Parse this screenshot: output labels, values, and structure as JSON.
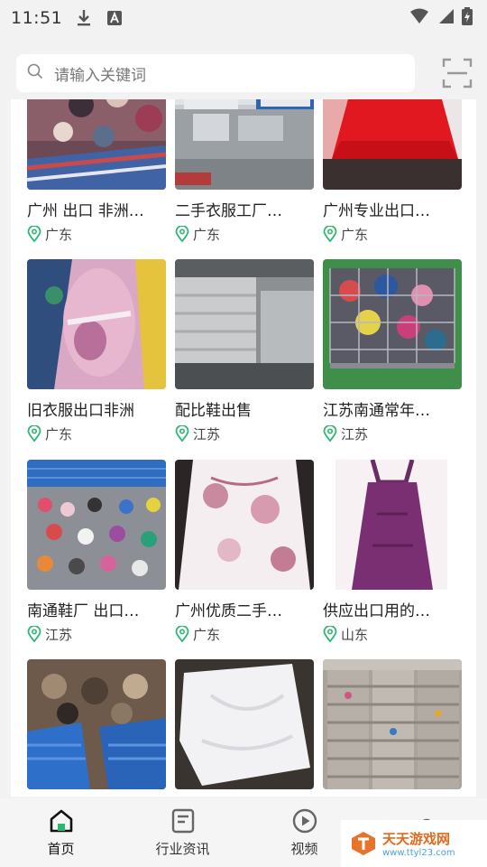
{
  "status": {
    "time": "11:51"
  },
  "search": {
    "placeholder": "请输入关键词"
  },
  "items": [
    {
      "title": "广州 出口 非洲…",
      "location": "广东"
    },
    {
      "title": "二手衣服工厂…",
      "location": "广东"
    },
    {
      "title": "广州专业出口…",
      "location": "广东"
    },
    {
      "title": "旧衣服出口非洲",
      "location": "广东"
    },
    {
      "title": "配比鞋出售",
      "location": "江苏"
    },
    {
      "title": "江苏南通常年…",
      "location": "江苏"
    },
    {
      "title": "南通鞋厂 出口…",
      "location": "江苏"
    },
    {
      "title": "广州优质二手…",
      "location": "广东"
    },
    {
      "title": "供应出口用的…",
      "location": "山东"
    },
    {
      "title": "",
      "location": ""
    },
    {
      "title": "",
      "location": ""
    },
    {
      "title": "",
      "location": ""
    }
  ],
  "nav": [
    {
      "label": "首页",
      "active": true
    },
    {
      "label": "行业资讯",
      "active": false
    },
    {
      "label": "视频",
      "active": false
    },
    {
      "label": "",
      "active": false
    }
  ],
  "watermark": {
    "name": "天天游戏网",
    "url": "www.ttyl23.com"
  }
}
